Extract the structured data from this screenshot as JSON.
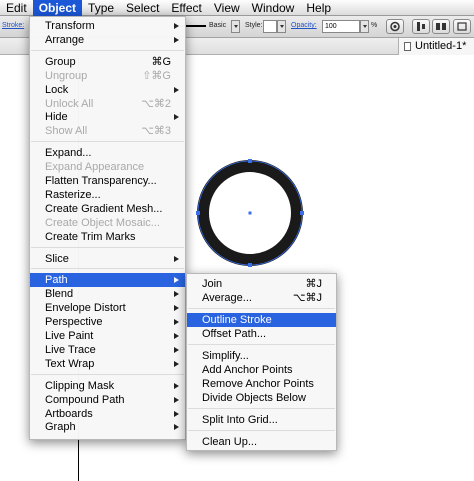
{
  "menubar": {
    "items": [
      "Edit",
      "Object",
      "Type",
      "Select",
      "Effect",
      "View",
      "Window",
      "Help"
    ],
    "active_index": 1
  },
  "control_bar": {
    "stroke_label": "Stroke:",
    "brush_value": "Basic",
    "style_label": "Style:",
    "opacity_label": "Opacity:",
    "opacity_value": "100",
    "opacity_unit": "%"
  },
  "document": {
    "tab_title": "Untitled-1*"
  },
  "object_menu": {
    "items": [
      {
        "label": "Transform",
        "submenu": true
      },
      {
        "label": "Arrange",
        "submenu": true
      },
      {
        "separator": true
      },
      {
        "label": "Group",
        "shortcut": "⌘G"
      },
      {
        "label": "Ungroup",
        "shortcut": "⇧⌘G",
        "disabled": true
      },
      {
        "label": "Lock",
        "submenu": true
      },
      {
        "label": "Unlock All",
        "shortcut": "⌥⌘2",
        "disabled": true
      },
      {
        "label": "Hide",
        "submenu": true
      },
      {
        "label": "Show All",
        "shortcut": "⌥⌘3",
        "disabled": true
      },
      {
        "separator": true
      },
      {
        "label": "Expand..."
      },
      {
        "label": "Expand Appearance",
        "disabled": true
      },
      {
        "label": "Flatten Transparency..."
      },
      {
        "label": "Rasterize..."
      },
      {
        "label": "Create Gradient Mesh..."
      },
      {
        "label": "Create Object Mosaic...",
        "disabled": true
      },
      {
        "label": "Create Trim Marks"
      },
      {
        "separator": true
      },
      {
        "label": "Slice",
        "submenu": true
      },
      {
        "separator": true
      },
      {
        "label": "Path",
        "submenu": true,
        "selected": true
      },
      {
        "label": "Blend",
        "submenu": true
      },
      {
        "label": "Envelope Distort",
        "submenu": true
      },
      {
        "label": "Perspective",
        "submenu": true
      },
      {
        "label": "Live Paint",
        "submenu": true
      },
      {
        "label": "Live Trace",
        "submenu": true
      },
      {
        "label": "Text Wrap",
        "submenu": true
      },
      {
        "separator": true
      },
      {
        "label": "Clipping Mask",
        "submenu": true
      },
      {
        "label": "Compound Path",
        "submenu": true
      },
      {
        "label": "Artboards",
        "submenu": true
      },
      {
        "label": "Graph",
        "submenu": true
      }
    ]
  },
  "path_menu": {
    "items": [
      {
        "label": "Join",
        "shortcut": "⌘J"
      },
      {
        "label": "Average...",
        "shortcut": "⌥⌘J"
      },
      {
        "separator": true
      },
      {
        "label": "Outline Stroke",
        "selected": true
      },
      {
        "label": "Offset Path..."
      },
      {
        "separator": true
      },
      {
        "label": "Simplify..."
      },
      {
        "label": "Add Anchor Points"
      },
      {
        "label": "Remove Anchor Points"
      },
      {
        "label": "Divide Objects Below"
      },
      {
        "separator": true
      },
      {
        "label": "Split Into Grid..."
      },
      {
        "separator": true
      },
      {
        "label": "Clean Up..."
      }
    ]
  },
  "colors": {
    "selection": "#2a63e0",
    "menubar_active": "#1b57d6",
    "anchor_points": "#3b6fe8",
    "ring_fill": "#1a1a1a"
  }
}
